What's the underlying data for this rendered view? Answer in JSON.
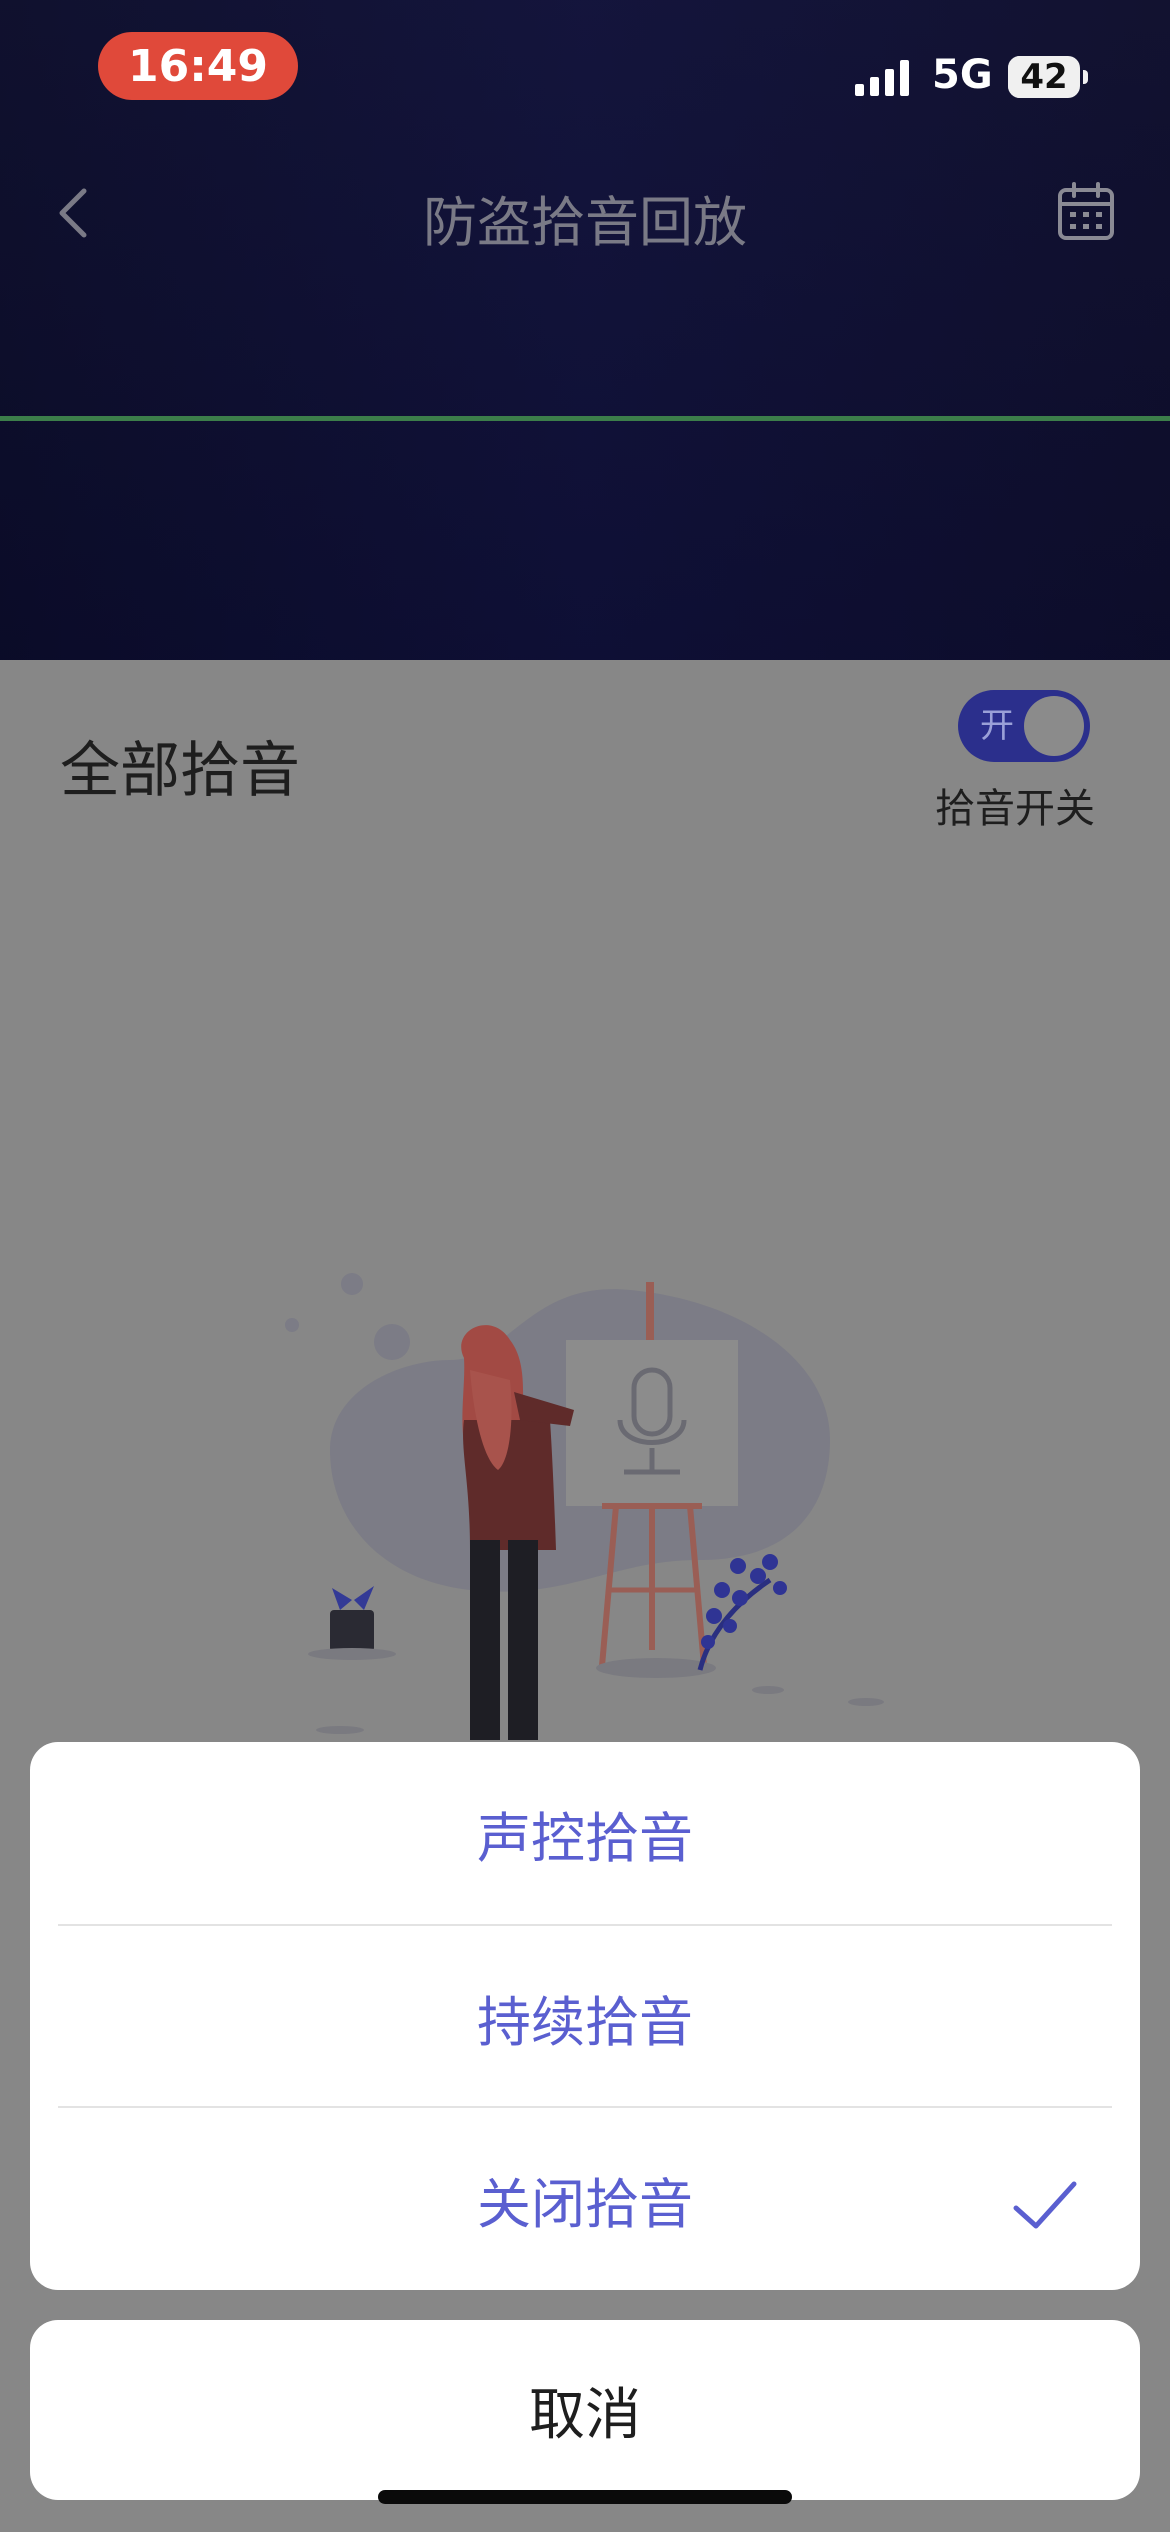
{
  "status_bar": {
    "time": "16:49",
    "network": "5G",
    "battery": "42"
  },
  "header": {
    "title": "防盗拾音回放",
    "back_icon": "chevron-left-icon",
    "calendar_icon": "calendar-icon"
  },
  "filter": {
    "label": "全部拾音",
    "toggle_state_text": "开",
    "toggle_on": true,
    "toggle_label": "拾音开关"
  },
  "action_sheet": {
    "options": [
      {
        "label": "声控拾音",
        "selected": false
      },
      {
        "label": "持续拾音",
        "selected": false
      },
      {
        "label": "关闭拾音",
        "selected": true
      }
    ],
    "cancel_label": "取消"
  },
  "colors": {
    "accent": "#5a5fd0",
    "time_pill": "#e0493a",
    "toggle_bg": "#2b2f8c",
    "progress_line": "#3c7e4a"
  }
}
